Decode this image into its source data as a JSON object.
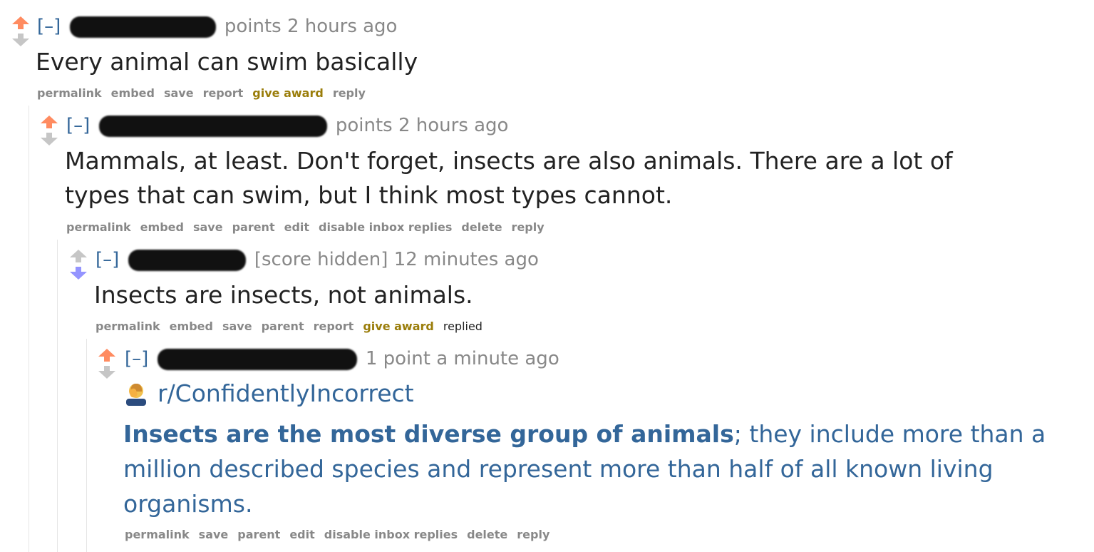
{
  "comments": [
    {
      "tagline": {
        "expand": "[–]",
        "score": "points",
        "time": "2 hours ago"
      },
      "body": "Every animal can swim basically",
      "buttons": [
        "permalink",
        "embed",
        "save",
        "report",
        "give award",
        "reply"
      ]
    },
    {
      "tagline": {
        "expand": "[–]",
        "score": "points",
        "time": "2 hours ago"
      },
      "body": "Mammals, at least. Don't forget, insects are also animals. There are a lot of types that can swim, but I think most types cannot.",
      "buttons": [
        "permalink",
        "embed",
        "save",
        "parent",
        "edit",
        "disable inbox replies",
        "delete",
        "reply"
      ]
    },
    {
      "tagline": {
        "expand": "[–]",
        "score": "[score hidden]",
        "time": "12 minutes ago"
      },
      "body": "Insects are insects, not animals.",
      "buttons": [
        "permalink",
        "embed",
        "save",
        "parent",
        "report",
        "give award",
        "replied"
      ]
    },
    {
      "tagline": {
        "expand": "[–]",
        "score": "1 point",
        "time": "a minute ago"
      },
      "subreddit": "r/ConfidentlyIncorrect",
      "quote_bold": "Insects are the most diverse group of animals",
      "quote_rest": "; they include more than a million described species and represent more than half of all known living organisms.",
      "buttons": [
        "permalink",
        "save",
        "parent",
        "edit",
        "disable inbox replies",
        "delete",
        "reply"
      ]
    }
  ],
  "colors": {
    "upvote": "#ff8b60",
    "downvote": "#9494ff",
    "neutral": "#c6c6c6",
    "link": "#336699",
    "gold": "#9a7d0a"
  },
  "icons": [
    "upvote-arrow-icon",
    "downvote-arrow-icon",
    "facepalm-icon"
  ]
}
